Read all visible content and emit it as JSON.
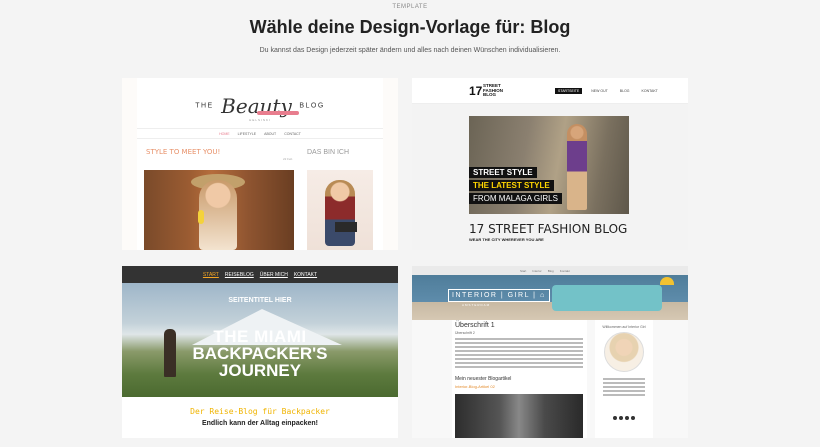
{
  "header": {
    "eyebrow": "TEMPLATE",
    "title": "Wähle deine Design-Vorlage für: Blog",
    "subtitle": "Du kannst das Design jederzeit später ändern und alles nach deinen Wünschen individualisieren."
  },
  "templates": [
    {
      "logo_the": "THE",
      "logo_beauty": "Beauty",
      "logo_blog": "BLOG",
      "logo_sub": "HELSINKI",
      "nav": [
        "HOME",
        "LIFESTYLE",
        "ABOUT",
        "CONTACT"
      ],
      "heading": "STYLE TO MEET YOU!",
      "side_heading": "DAS BIN ICH",
      "date": "22 Feb"
    },
    {
      "logo_number": "17",
      "logo_text_line1": "STREET",
      "logo_text_line2": "FASHION",
      "logo_text_line3": "BLOG",
      "nav": [
        "STARTSEITE",
        "NEW OUT",
        "BLOG",
        "KONTAKT"
      ],
      "strip1": "STREET STYLE",
      "strip2": "THE LATEST STYLE",
      "strip3": "FROM MALAGA GIRLS",
      "title": "17 STREET FASHION BLOG",
      "subtitle": "WEAR THE CITY WHEREVER YOU ARE"
    },
    {
      "nav": [
        "START",
        "REISEBLOG",
        "ÜBER MICH",
        "KONTAKT"
      ],
      "kicker": "SEITENTITEL HIER",
      "title_line1": "THE MIAMI",
      "title_line2": "BACKPACKER'S",
      "title_line3": "JOURNEY",
      "tagline": "Der Reise-Blog für Backpacker",
      "tagline2": "Endlich kann der Alltag einpacken!"
    },
    {
      "topbar": [
        "Start",
        "Interior",
        "Blog",
        "Kontakt"
      ],
      "brand": "INTERIOR | GIRL | ⌂",
      "brand_sub": "AMSTERDAM",
      "heading": "Überschrift 1",
      "heading_sub": "Überschrift 2",
      "latest": "Mein neuester Blogartikel",
      "latest_link": "Interior-Blog-Artikel 02",
      "side_heading": "Willkommen auf Interior Girl"
    }
  ]
}
